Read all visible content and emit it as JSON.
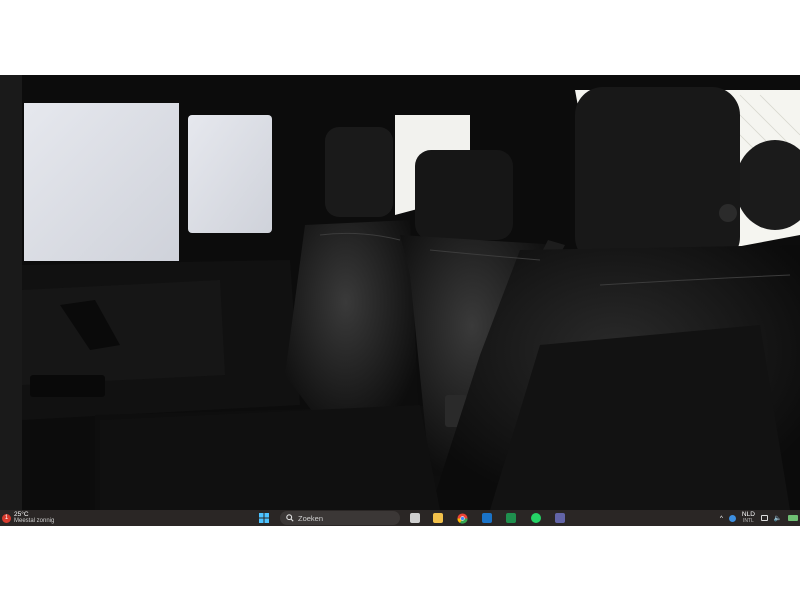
{
  "viewer": {
    "image_alt": "Rear seat interior, black leather"
  },
  "taskbar": {
    "weather": {
      "badge": "1",
      "temperature": "25°C",
      "condition": "Meestal zonnig"
    },
    "search": {
      "placeholder": "Zoeken"
    },
    "apps": [
      {
        "name": "File Explorer",
        "icon": "folder-icon",
        "color": "#f2c14b"
      },
      {
        "name": "Chrome",
        "icon": "chrome-icon",
        "color": "#ea4335"
      },
      {
        "name": "Outlook",
        "icon": "outlook-icon",
        "color": "#1a73c8"
      },
      {
        "name": "Excel",
        "icon": "excel-icon",
        "color": "#1f8f4e"
      },
      {
        "name": "WhatsApp",
        "icon": "whatsapp-icon",
        "color": "#25d366"
      },
      {
        "name": "Teams",
        "icon": "teams-icon",
        "color": "#6264a7"
      }
    ],
    "tray": {
      "language_top": "NLD",
      "language_bottom": "INTL"
    }
  }
}
